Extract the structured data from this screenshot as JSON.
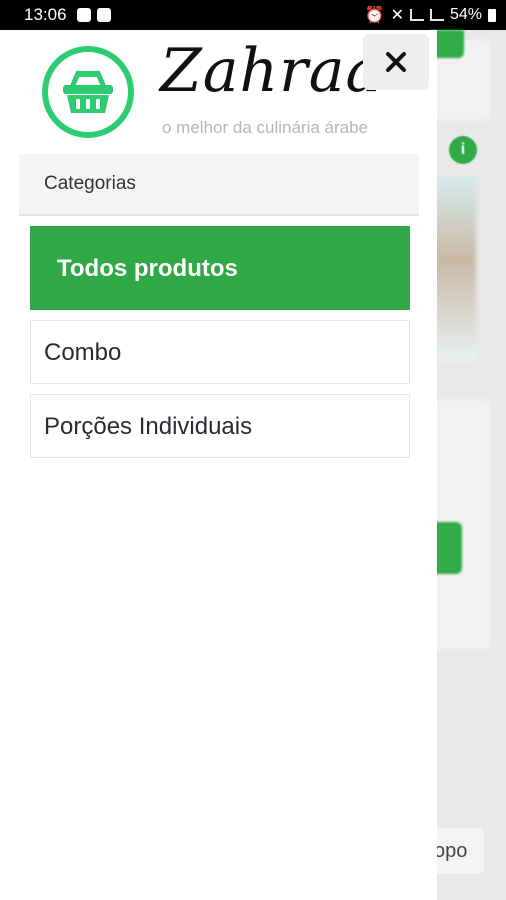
{
  "status_bar": {
    "time": "13:06",
    "battery": "54%",
    "icons": [
      "message-icon",
      "image-icon",
      "alarm-icon",
      "mute-icon",
      "wifi-icon",
      "signal-icon",
      "battery-icon"
    ]
  },
  "drawer": {
    "brand_name": "Zahraa",
    "brand_tagline": "o melhor da culinária árabe",
    "close_label": "×",
    "section_label": "Categorias",
    "menu": [
      {
        "label": "Todos produtos"
      },
      {
        "label": "Combo"
      },
      {
        "label": "Porções Individuais"
      }
    ]
  },
  "background": {
    "info_badge": "i",
    "topo_label": "opo"
  },
  "colors": {
    "accent": "#30a846",
    "logo_ring": "#2ecc71"
  }
}
